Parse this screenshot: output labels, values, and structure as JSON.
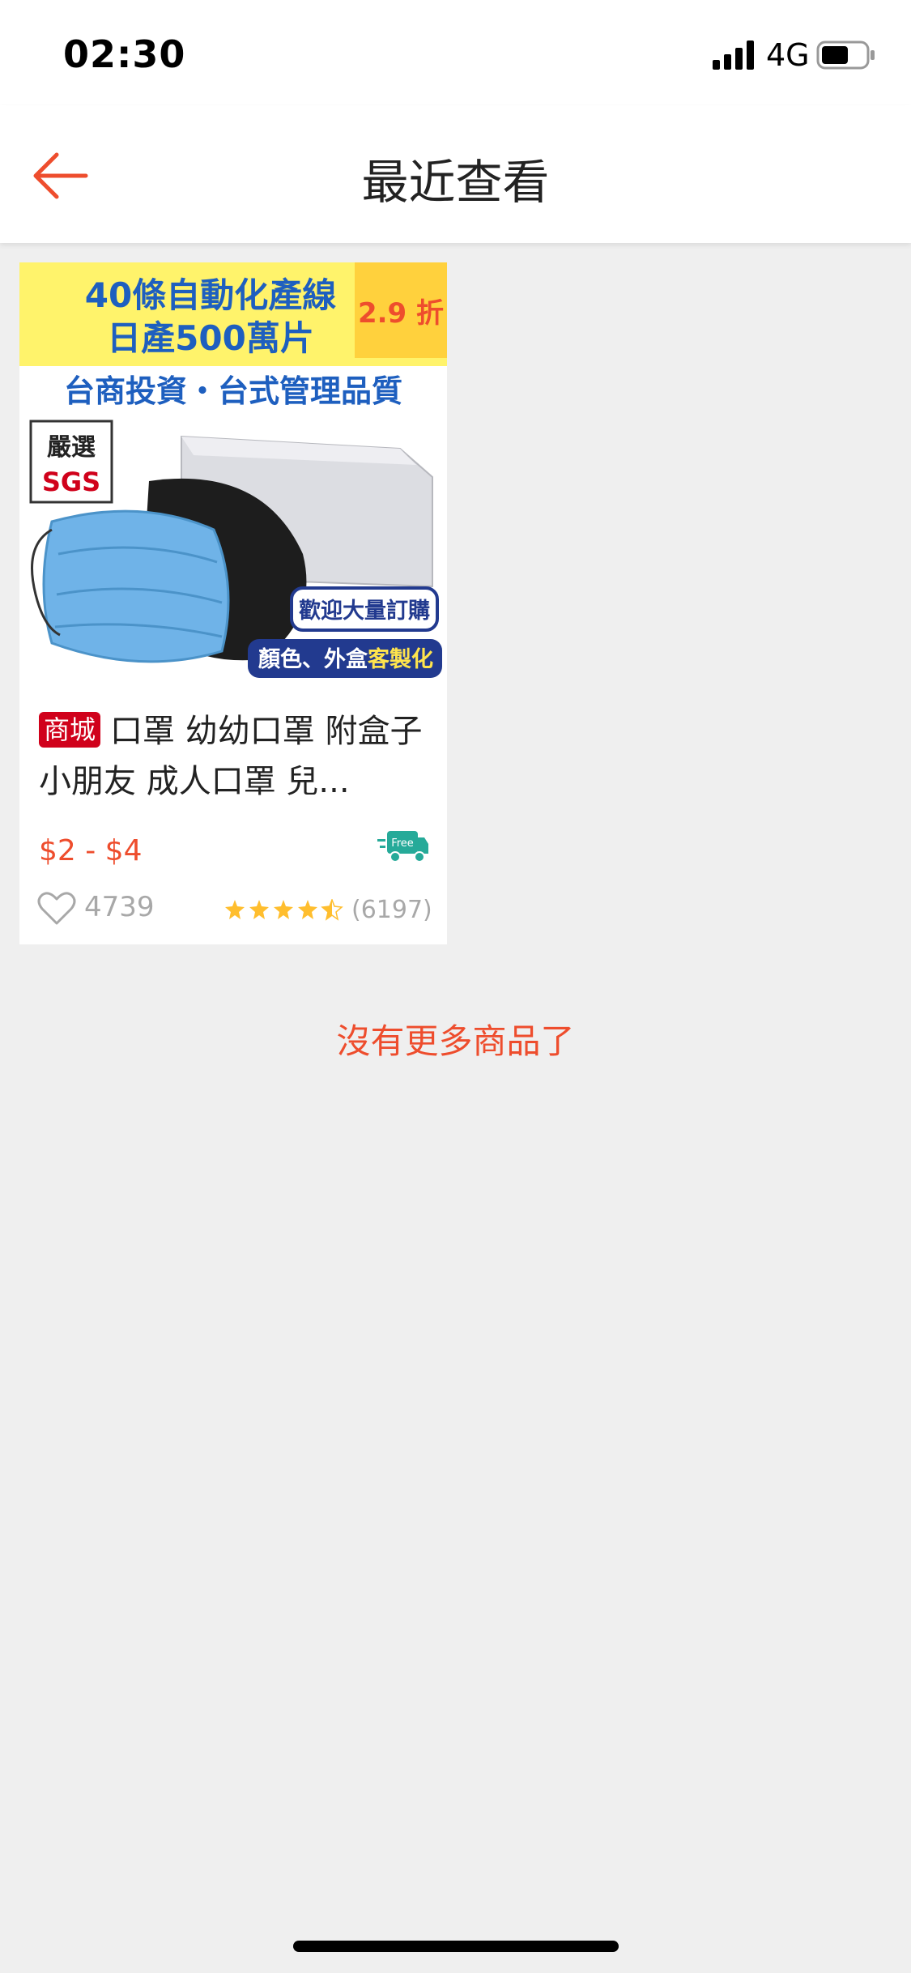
{
  "status_bar": {
    "time": "02:30",
    "network": "4G",
    "icons": [
      "signal-icon",
      "battery-icon"
    ]
  },
  "header": {
    "title": "最近查看",
    "back_icon": "arrow-left-icon"
  },
  "colors": {
    "accent": "#ee4d2d",
    "mall_badge": "#d0011b",
    "discount_bg": "#ffd13d",
    "star": "#ffbe2e"
  },
  "product": {
    "image_text": {
      "line1": "40條自動化產線",
      "line2": "日產500萬片",
      "line3": "台商投資・台式管理品質",
      "badge_top": "嚴選",
      "badge_bottom": "SGS",
      "callout1": "歡迎大量訂購",
      "callout2_prefix": "顏色、外盒",
      "callout2_highlight": "客製化"
    },
    "discount": "2.9 折",
    "mall_label": "商城",
    "name": "口罩 幼幼口罩 附盒子 小朋友 成人口罩 兒...",
    "price": "$2 - $4",
    "free_shipping_label": "Free",
    "likes": "4739",
    "rating": 4.5,
    "rating_count": "(6197)"
  },
  "footer": {
    "no_more_text": "沒有更多商品了"
  }
}
